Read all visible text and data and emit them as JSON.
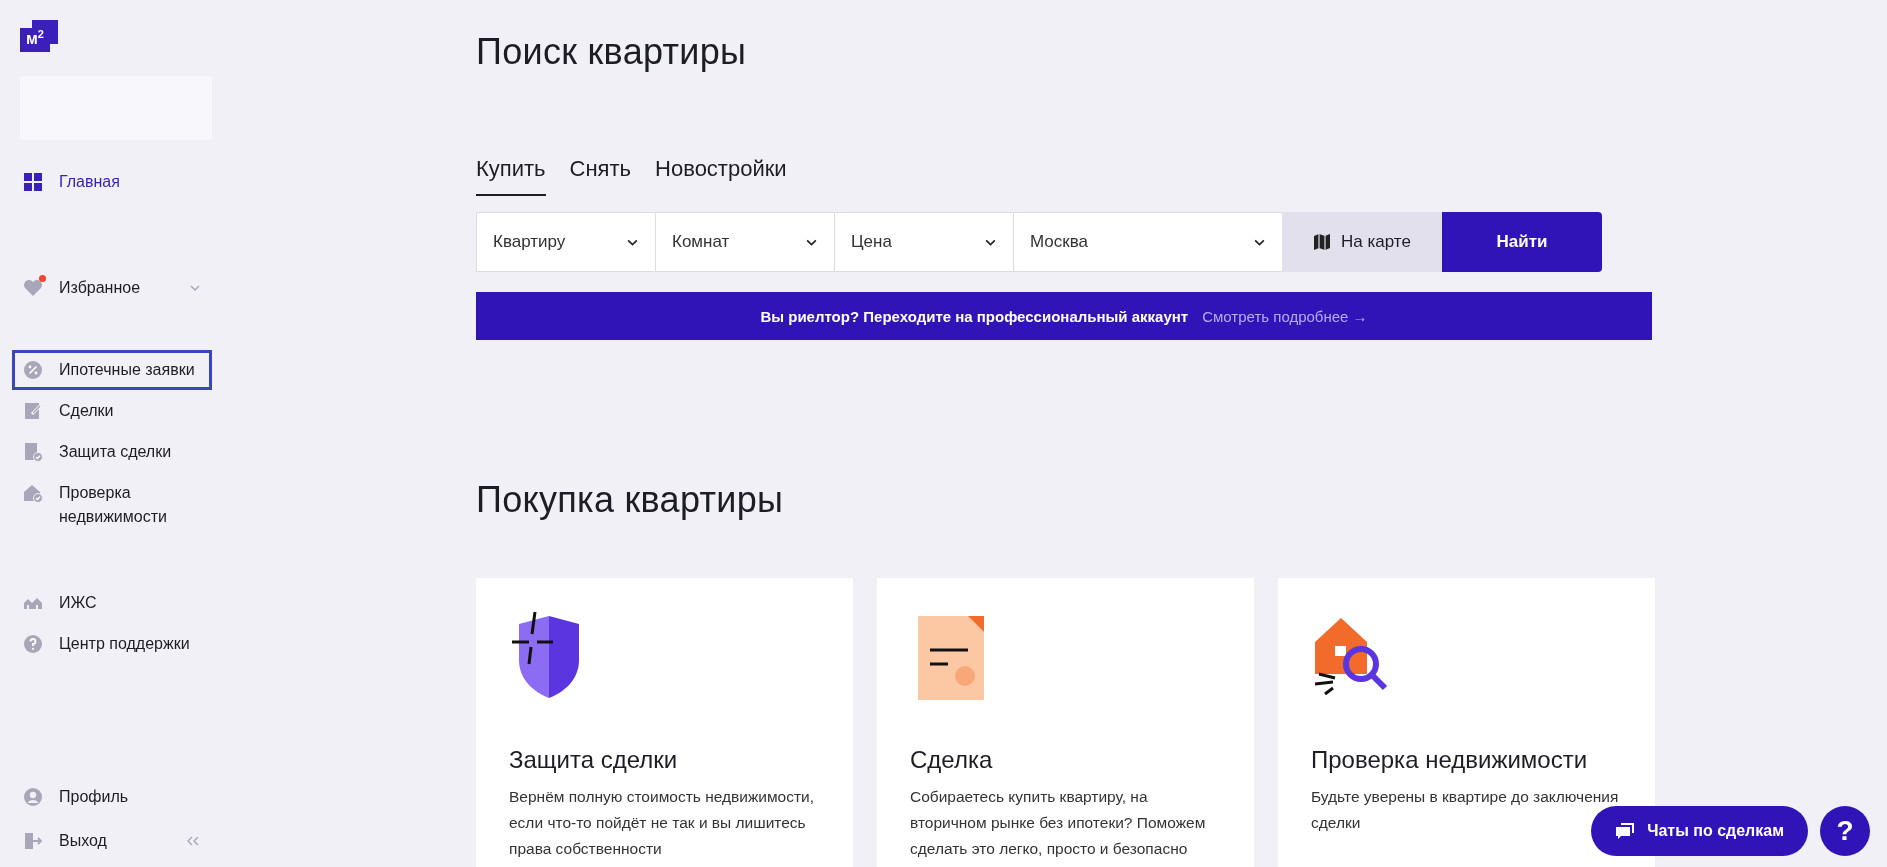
{
  "logo": "м$^{2}$",
  "sidebar": {
    "sections": [
      [
        {
          "label": "Главная",
          "selected": true,
          "focused": false
        }
      ],
      [
        {
          "label": "Избранное",
          "selected": false,
          "focused": false,
          "notification": true,
          "expanded": false
        }
      ],
      [
        {
          "label": "Ипотечные заявки",
          "selected": false,
          "focused": true
        },
        {
          "label": "Сделки",
          "selected": false,
          "focused": false
        },
        {
          "label": "Защита сделки",
          "selected": false,
          "focused": false
        },
        {
          "label": "Проверка недвижимости",
          "selected": false,
          "focused": false
        }
      ],
      [
        {
          "label": "ИЖС",
          "selected": false,
          "focused": false
        },
        {
          "label": "Центр поддержки",
          "selected": false,
          "focused": false
        }
      ]
    ],
    "footer": [
      {
        "label": "Профиль",
        "selected": false,
        "focused": false
      },
      {
        "label": "Выход",
        "selected": false,
        "focused": false
      }
    ]
  },
  "search": {
    "title": "Поиск квартиры",
    "tabs": [
      {
        "label": "Купить",
        "selected": true
      },
      {
        "label": "Снять",
        "selected": false
      },
      {
        "label": "Новостройки",
        "selected": false
      }
    ],
    "filters": [
      {
        "value": "Квартиру"
      },
      {
        "value": "Комнат"
      },
      {
        "value": "Цена"
      },
      {
        "value": "Москва"
      }
    ],
    "map_button": "На карте",
    "find_button": "Найти"
  },
  "banner": {
    "text": "Вы риелтор? Переходите на профессиональный аккаунт",
    "link": "Смотреть подробнее →"
  },
  "purchase": {
    "title": "Покупка квартиры",
    "cards": [
      {
        "title": "Защита сделки",
        "text": "Вернём полную стоимость недвижимости, если что-то пойдёт не так и вы лишитесь права собственности"
      },
      {
        "title": "Сделка",
        "text": "Собираетесь купить квартиру, на вторичном рынке без ипотеки? Поможем сделать это легко, просто и безопасно"
      },
      {
        "title": "Проверка недвижимости",
        "text": "Будьте уверены в квартире до заключения сделки"
      }
    ]
  },
  "chat_button": "Чаты по сделкам",
  "help_button": "?"
}
